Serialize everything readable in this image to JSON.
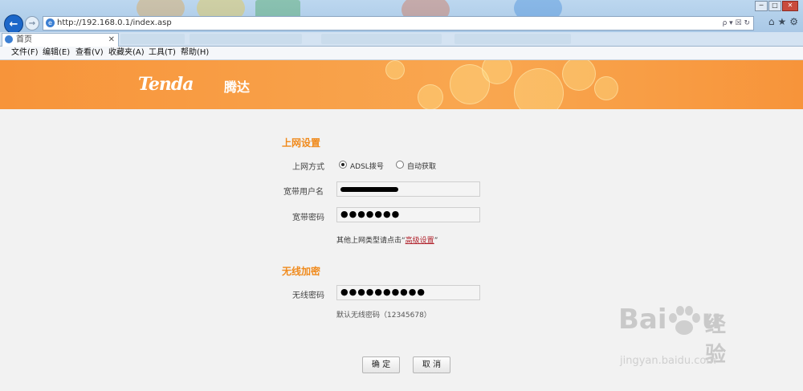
{
  "browser": {
    "url": "http://192.168.0.1/index.asp",
    "address_tools": "ρ ▾ ☒ ↻",
    "tab_label": "首页",
    "tab_close": "✕",
    "menu": [
      "文件(F)",
      "编辑(E)",
      "查看(V)",
      "收藏夹(A)",
      "工具(T)",
      "帮助(H)"
    ]
  },
  "header": {
    "logo_text": "Tenda",
    "logo_cn": "腾达",
    "brand_color": "#f7943a"
  },
  "internet": {
    "section_title": "上网设置",
    "mode_label": "上网方式",
    "options": [
      "ADSL拨号",
      "自动获取"
    ],
    "selected": "ADSL拨号",
    "username_label": "宽带用户名",
    "password_label": "宽带密码",
    "password_masked": "●●●●●●●",
    "hint_prefix": "其他上网类型请点击“",
    "hint_link": "高级设置",
    "hint_suffix": "”"
  },
  "wireless": {
    "section_title": "无线加密",
    "password_label": "无线密码",
    "password_masked": "●●●●●●●●●●",
    "default_hint": "默认无线密码（12345678）"
  },
  "actions": {
    "ok_label": "确 定",
    "cancel_label": "取 消"
  },
  "watermark": {
    "logo": "Bai",
    "logo_end": "u",
    "cn": "经验",
    "sub": "jingyan.baidu.com"
  }
}
